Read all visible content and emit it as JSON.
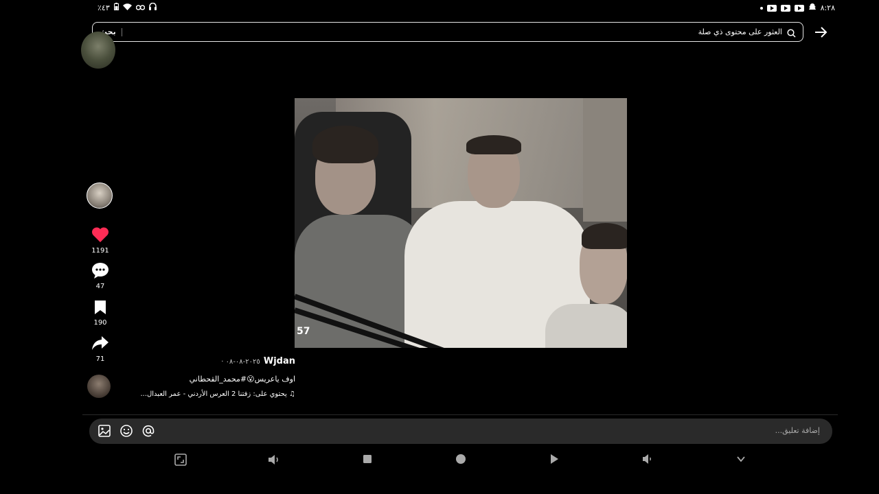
{
  "status_bar": {
    "time": "٨:٢٨",
    "battery": "٪٤٣"
  },
  "search": {
    "button_label": "بحث",
    "placeholder": "العثور على محتوى ذي صلة"
  },
  "video": {
    "overlay_number": "57"
  },
  "actions": {
    "likes": "1191",
    "comments": "47",
    "saves": "190",
    "shares": "71"
  },
  "post": {
    "author": "Wjdan",
    "date": "٢٠٢٥-٠٨-٠٨ ·",
    "caption": "اوف ياعريس😮#محمد_القحطاني",
    "music": "يحتوي على: زفتنا 2 العرس الأردني - عمر العبدال..."
  },
  "comment": {
    "placeholder": "إضافة تعليق..."
  },
  "colors": {
    "like": "#fe2c55",
    "background": "#000000"
  }
}
